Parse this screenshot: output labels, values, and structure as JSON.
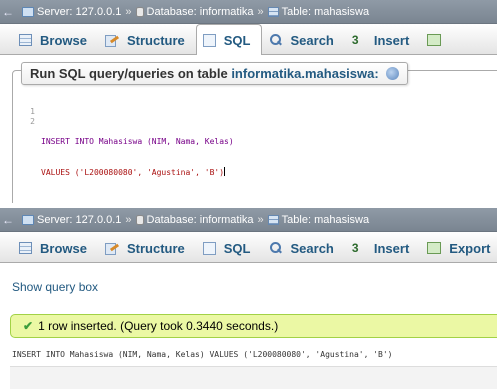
{
  "breadcrumb": {
    "server_label": "Server:",
    "server_value": "127.0.0.1",
    "database_label": "Database:",
    "database_value": "informatika",
    "table_label": "Table:",
    "table_value": "mahasiswa",
    "separator": "»"
  },
  "tabs": {
    "browse": "Browse",
    "structure": "Structure",
    "sql": "SQL",
    "search": "Search",
    "insert": "Insert",
    "export": "Export"
  },
  "sql_box": {
    "title_prefix": "Run SQL query/queries on table",
    "title_link": "informatika.mahasiswa:",
    "lines": [
      {
        "number": "1",
        "text": "INSERT INTO Mahasiswa (NIM, Nama, Kelas)"
      },
      {
        "number": "2",
        "text": "VALUES ('L200080080', 'Agustina', 'B')"
      }
    ]
  },
  "result": {
    "show_query_box": "Show query box",
    "success_message": "1 row inserted. (Query took 0.3440 seconds.)",
    "executed_query": "INSERT INTO Mahasiswa (NIM, Nama, Kelas) VALUES ('L200080080', 'Agustina', 'B')"
  },
  "colors": {
    "link": "#235a81",
    "success_bg": "#ebf8a4",
    "success_border": "#a2d246",
    "crumbbar_bg": "#8f9aa6"
  }
}
